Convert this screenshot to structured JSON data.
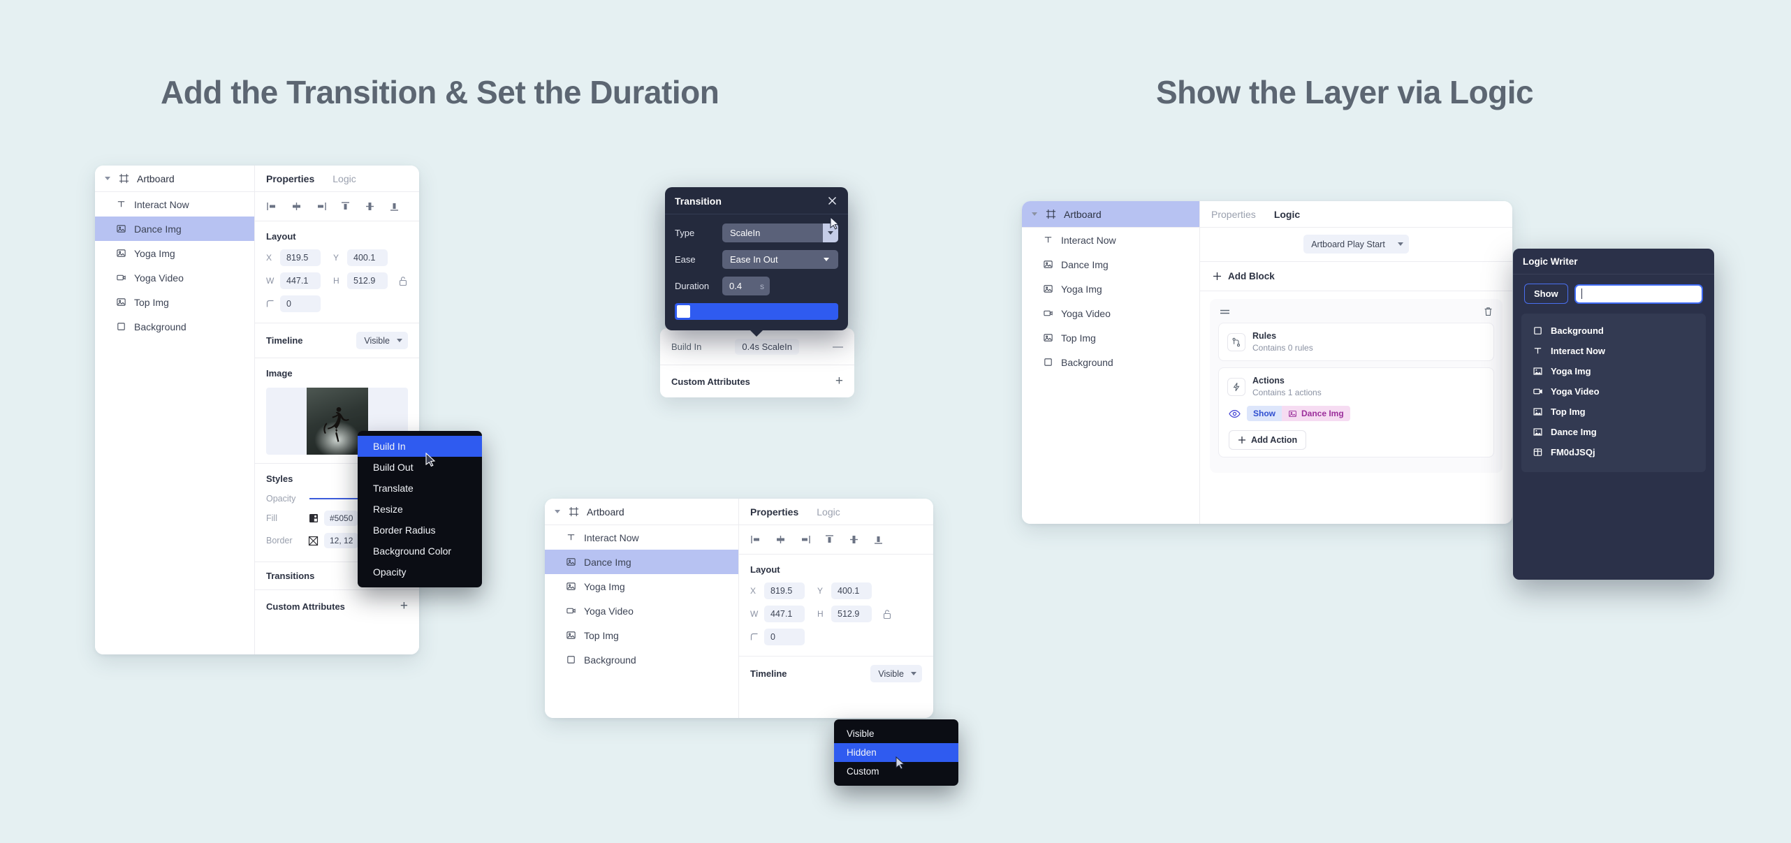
{
  "background_color": "#e5f0f2",
  "headings": {
    "left": "Add the Transition & Set the Duration",
    "right": "Show the Layer via Logic"
  },
  "layers": {
    "artboard_label": "Artboard",
    "items": [
      {
        "label": "Interact Now",
        "icon": "text-icon"
      },
      {
        "label": "Dance Img",
        "icon": "image-icon"
      },
      {
        "label": "Yoga Img",
        "icon": "image-icon"
      },
      {
        "label": "Yoga Video",
        "icon": "video-icon"
      },
      {
        "label": "Top Img",
        "icon": "image-icon"
      },
      {
        "label": "Background",
        "icon": "square-icon"
      }
    ],
    "selected": "Dance Img"
  },
  "properties": {
    "tabs": {
      "properties": "Properties",
      "logic": "Logic"
    },
    "layout": {
      "title": "Layout",
      "x_label": "X",
      "x_value": "819.5",
      "y_label": "Y",
      "y_value": "400.1",
      "w_label": "W",
      "w_value": "447.1",
      "h_label": "H",
      "h_value": "512.9",
      "radius_value": "0"
    },
    "timeline": {
      "label": "Timeline",
      "value": "Visible"
    },
    "image": {
      "title": "Image"
    },
    "styles": {
      "title": "Styles",
      "opacity_label": "Opacity",
      "fill_label": "Fill",
      "fill_value": "#5050",
      "border_label": "Border",
      "border_value": "12, 12"
    },
    "transitions_title": "Transitions",
    "custom_attributes_title": "Custom Attributes",
    "add_symbol": "+"
  },
  "context_menu": {
    "items": [
      {
        "label": "Build In",
        "highlighted": true
      },
      {
        "label": "Build Out",
        "highlighted": false
      },
      {
        "label": "Translate",
        "highlighted": false
      },
      {
        "label": "Resize",
        "highlighted": false
      },
      {
        "label": "Border Radius",
        "highlighted": false
      },
      {
        "label": "Background Color",
        "highlighted": false
      },
      {
        "label": "Opacity",
        "highlighted": false
      }
    ]
  },
  "transition_dialog": {
    "title": "Transition",
    "type_label": "Type",
    "type_value": "ScaleIn",
    "ease_label": "Ease",
    "ease_value": "Ease In Out",
    "duration_label": "Duration",
    "duration_value": "0.4",
    "duration_unit": "s"
  },
  "build_in_card": {
    "label": "Build In",
    "value": "0.4s ScaleIn",
    "remove_symbol": "—",
    "custom_attributes_title": "Custom Attributes",
    "add_symbol": "+"
  },
  "timeline_dropdown": {
    "options": [
      {
        "label": "Visible",
        "highlighted": false
      },
      {
        "label": "Hidden",
        "highlighted": true
      },
      {
        "label": "Custom",
        "highlighted": false
      }
    ]
  },
  "logic_panel": {
    "trigger_value": "Artboard Play Start",
    "add_block_label": "Add Block",
    "rules": {
      "title": "Rules",
      "subtitle": "Contains 0 rules"
    },
    "actions": {
      "title": "Actions",
      "subtitle": "Contains 1 actions"
    },
    "action_chip": {
      "verb": "Show",
      "target": "Dance Img"
    },
    "add_action_label": "Add Action"
  },
  "logic_writer": {
    "title": "Logic Writer",
    "verb_button": "Show",
    "input_value": "",
    "suggestions": [
      {
        "label": "Background",
        "icon": "square-icon"
      },
      {
        "label": "Interact Now",
        "icon": "text-icon"
      },
      {
        "label": "Yoga Img",
        "icon": "image-icon"
      },
      {
        "label": "Yoga Video",
        "icon": "video-icon"
      },
      {
        "label": "Top Img",
        "icon": "image-icon"
      },
      {
        "label": "Dance Img",
        "icon": "image-icon"
      },
      {
        "label": "FM0dJSQj",
        "icon": "table-icon"
      }
    ]
  }
}
